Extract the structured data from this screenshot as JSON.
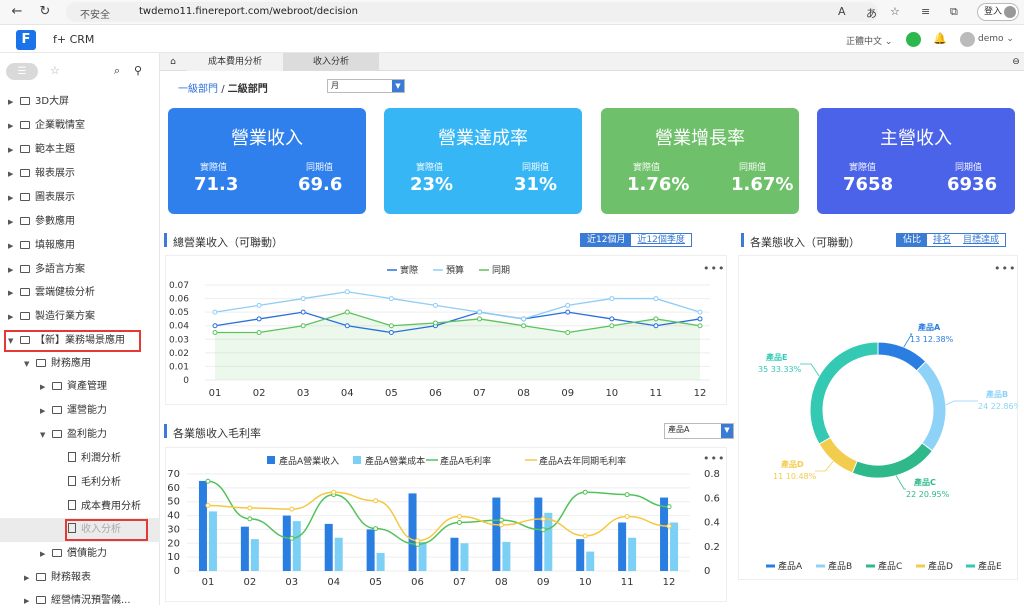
{
  "browser": {
    "insecure_label": "不安全",
    "url": "twdemo11.finereport.com/webroot/decision",
    "login_label": "登入"
  },
  "app": {
    "name": "f+ CRM",
    "language": "正體中文",
    "user": "demo"
  },
  "sidebar": {
    "items": [
      {
        "label": "3D大屏",
        "level": 0
      },
      {
        "label": "企業戰情室",
        "level": 0
      },
      {
        "label": "範本主題",
        "level": 0
      },
      {
        "label": "報表展示",
        "level": 0
      },
      {
        "label": "圖表展示",
        "level": 0
      },
      {
        "label": "參數應用",
        "level": 0
      },
      {
        "label": "填報應用",
        "level": 0
      },
      {
        "label": "多語言方案",
        "level": 0
      },
      {
        "label": "雲端健檢分析",
        "level": 0
      },
      {
        "label": "製造行業方案",
        "level": 0
      },
      {
        "label": "【新】業務場景應用",
        "level": 0
      },
      {
        "label": "財務應用",
        "level": 1
      },
      {
        "label": "資產管理",
        "level": 2
      },
      {
        "label": "運營能力",
        "level": 2
      },
      {
        "label": "盈利能力",
        "level": 2
      },
      {
        "label": "利潤分析",
        "level": 3
      },
      {
        "label": "毛利分析",
        "level": 3
      },
      {
        "label": "成本費用分析",
        "level": 3
      },
      {
        "label": "收入分析",
        "level": 3
      },
      {
        "label": "償債能力",
        "level": 2
      },
      {
        "label": "財務報表",
        "level": 1
      },
      {
        "label": "經營情況預警儀...",
        "level": 1
      }
    ]
  },
  "tabs": [
    "成本費用分析",
    "收入分析"
  ],
  "breadcrumb": {
    "level1": "一級部門",
    "sep": "/",
    "level2": "二級部門"
  },
  "period_select": "月",
  "kpis": [
    {
      "title": "營業收入",
      "actual_label": "實際值",
      "actual": "71.3",
      "prior_label": "同期值",
      "prior": "69.6",
      "color": "#2f80ed"
    },
    {
      "title": "營業達成率",
      "actual_label": "實際值",
      "actual": "23%",
      "prior_label": "同期值",
      "prior": "31%",
      "color": "#37b6f5"
    },
    {
      "title": "營業增長率",
      "actual_label": "實際值",
      "actual": "1.76%",
      "prior_label": "同期值",
      "prior": "1.67%",
      "color": "#6fc06a"
    },
    {
      "title": "主營收入",
      "actual_label": "實際值",
      "actual": "7658",
      "prior_label": "同期值",
      "prior": "6936",
      "color": "#4b63e8"
    }
  ],
  "panel1": {
    "title": "總營業收入（可聯動）",
    "btn_a": "近12個月",
    "btn_b": "近12個季度"
  },
  "panel2": {
    "title": "各業態收入（可聯動）",
    "btn_a": "佔比",
    "btn_b": "排名",
    "btn_c": "目標達成"
  },
  "panel3": {
    "title": "各業態收入毛利率",
    "select": "產品A"
  },
  "chart_data": [
    {
      "type": "line",
      "x": [
        "01",
        "02",
        "03",
        "04",
        "05",
        "06",
        "07",
        "08",
        "09",
        "10",
        "11",
        "12"
      ],
      "ylim": [
        0,
        0.07
      ],
      "yticks": [
        "0",
        "0.01",
        "0.02",
        "0.03",
        "0.04",
        "0.05",
        "0.06",
        "0.07"
      ],
      "series": [
        {
          "name": "實際",
          "color": "#2a6fdb",
          "values": [
            0.04,
            0.045,
            0.05,
            0.04,
            0.035,
            0.04,
            0.05,
            0.045,
            0.05,
            0.045,
            0.04,
            0.045
          ]
        },
        {
          "name": "預算",
          "color": "#8fcdf6",
          "values": [
            0.05,
            0.055,
            0.06,
            0.065,
            0.06,
            0.055,
            0.05,
            0.045,
            0.055,
            0.06,
            0.06,
            0.05
          ]
        },
        {
          "name": "同期",
          "color": "#5cc25c",
          "values": [
            0.035,
            0.035,
            0.04,
            0.05,
            0.04,
            0.042,
            0.045,
            0.04,
            0.035,
            0.04,
            0.045,
            0.04
          ]
        }
      ]
    },
    {
      "type": "pie",
      "legend": [
        "產品A",
        "產品B",
        "產品C",
        "產品D",
        "產品E"
      ],
      "slices": [
        {
          "name": "產品A",
          "value": 13,
          "pct": "12.38%",
          "color": "#2a7de1"
        },
        {
          "name": "產品B",
          "value": 24,
          "pct": "22.86%",
          "color": "#8ed3f7"
        },
        {
          "name": "產品C",
          "value": 22,
          "pct": "20.95%",
          "color": "#2fb98b"
        },
        {
          "name": "產品D",
          "value": 11,
          "pct": "10.48%",
          "color": "#f2cc4c"
        },
        {
          "name": "產品E",
          "value": 35,
          "pct": "33.33%",
          "color": "#33c9b3"
        }
      ]
    },
    {
      "type": "bar",
      "x": [
        "01",
        "02",
        "03",
        "04",
        "05",
        "06",
        "07",
        "08",
        "09",
        "10",
        "11",
        "12"
      ],
      "ylim": [
        0,
        70
      ],
      "y2lim": [
        0,
        0.8
      ],
      "yticks": [
        "0",
        "10",
        "20",
        "30",
        "40",
        "50",
        "60",
        "70"
      ],
      "y2ticks": [
        "0",
        "0.2",
        "0.4",
        "0.6",
        "0.8"
      ],
      "series": [
        {
          "name": "產品A營業收入",
          "kind": "bar",
          "color": "#2a7de1",
          "values": [
            65,
            32,
            40,
            34,
            30,
            56,
            24,
            53,
            53,
            23,
            35,
            53
          ]
        },
        {
          "name": "產品A營業成本",
          "kind": "bar",
          "color": "#7dd0f5",
          "values": [
            43,
            23,
            36,
            24,
            13,
            21,
            20,
            21,
            42,
            14,
            24,
            35
          ]
        },
        {
          "name": "產品A毛利率",
          "kind": "line",
          "color": "#52c25a",
          "values": [
            0.74,
            0.43,
            0.27,
            0.63,
            0.35,
            0.22,
            0.4,
            0.42,
            0.34,
            0.65,
            0.63,
            0.53
          ]
        },
        {
          "name": "產品A去年同期毛利率",
          "kind": "line",
          "color": "#f5c842",
          "values": [
            0.54,
            0.52,
            0.51,
            0.65,
            0.58,
            0.25,
            0.45,
            0.38,
            0.43,
            0.29,
            0.45,
            0.37
          ]
        }
      ]
    }
  ]
}
